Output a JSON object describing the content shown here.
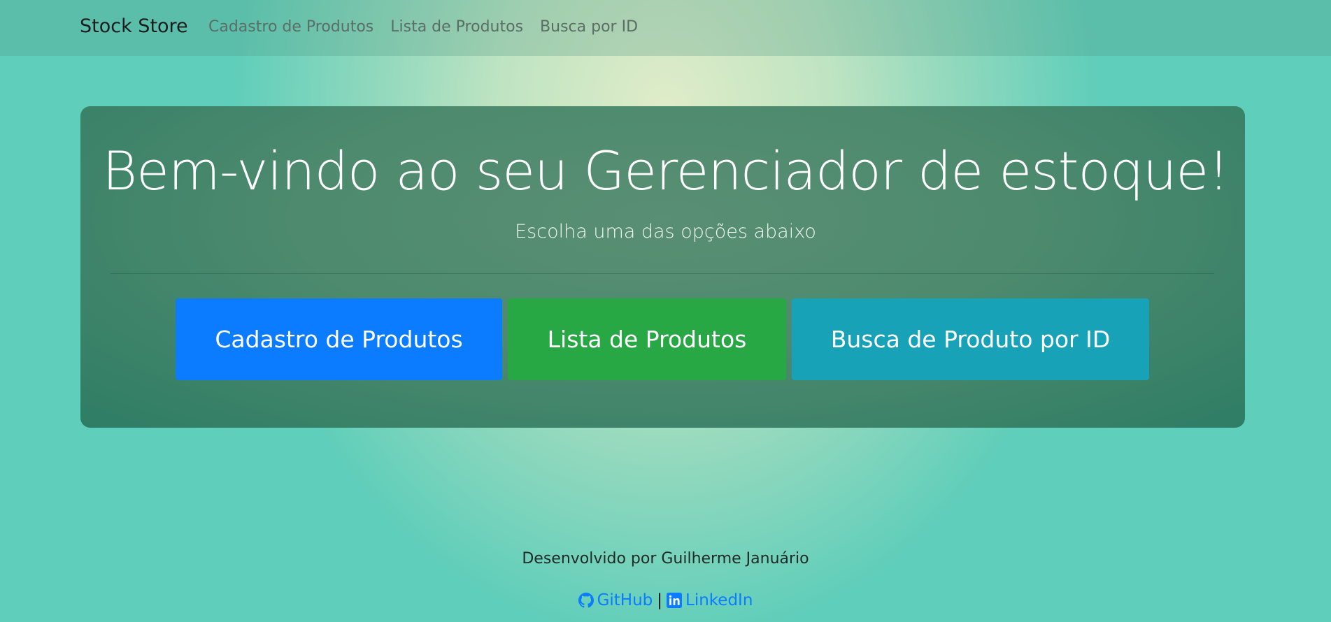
{
  "navbar": {
    "brand": "Stock Store",
    "links": [
      "Cadastro de Produtos",
      "Lista de Produtos",
      "Busca por ID"
    ]
  },
  "hero": {
    "title": "Bem-vindo ao seu Gerenciador de estoque!",
    "subtitle": "Escolha uma das opções abaixo",
    "buttons": [
      "Cadastro de Produtos",
      "Lista de Produtos",
      "Busca de Produto por ID"
    ]
  },
  "footer": {
    "credit": "Desenvolvido por Guilherme Januário",
    "github_label": "GitHub",
    "separator": "|",
    "linkedin_label": "LinkedIn"
  },
  "icons": {
    "github": "github-icon",
    "linkedin": "linkedin-icon"
  },
  "colors": {
    "primary": "#0b7bff",
    "success": "#28a745",
    "info": "#17a2b8"
  }
}
